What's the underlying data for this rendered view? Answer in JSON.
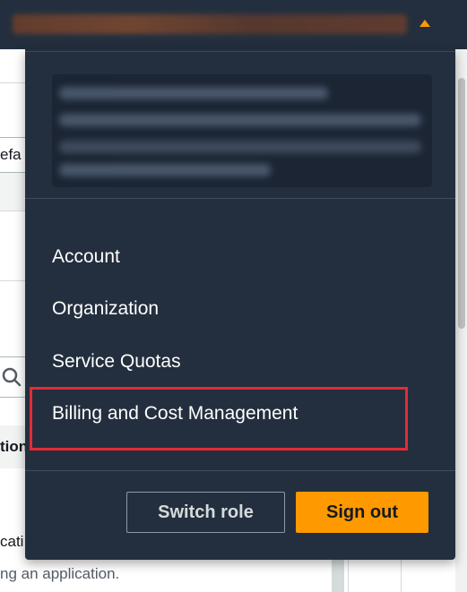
{
  "background": {
    "input_fragment": "efa",
    "column_header_fragment": "tion",
    "text_fragment": "cati",
    "text_line": "ng an application."
  },
  "menu": {
    "items": [
      {
        "label": "Account"
      },
      {
        "label": "Organization"
      },
      {
        "label": "Service Quotas"
      },
      {
        "label": "Billing and Cost Management"
      }
    ],
    "switch_role_label": "Switch role",
    "sign_out_label": "Sign out"
  },
  "colors": {
    "navbar": "#232f3e",
    "accent": "#ff9900",
    "highlight": "#e22c34"
  }
}
